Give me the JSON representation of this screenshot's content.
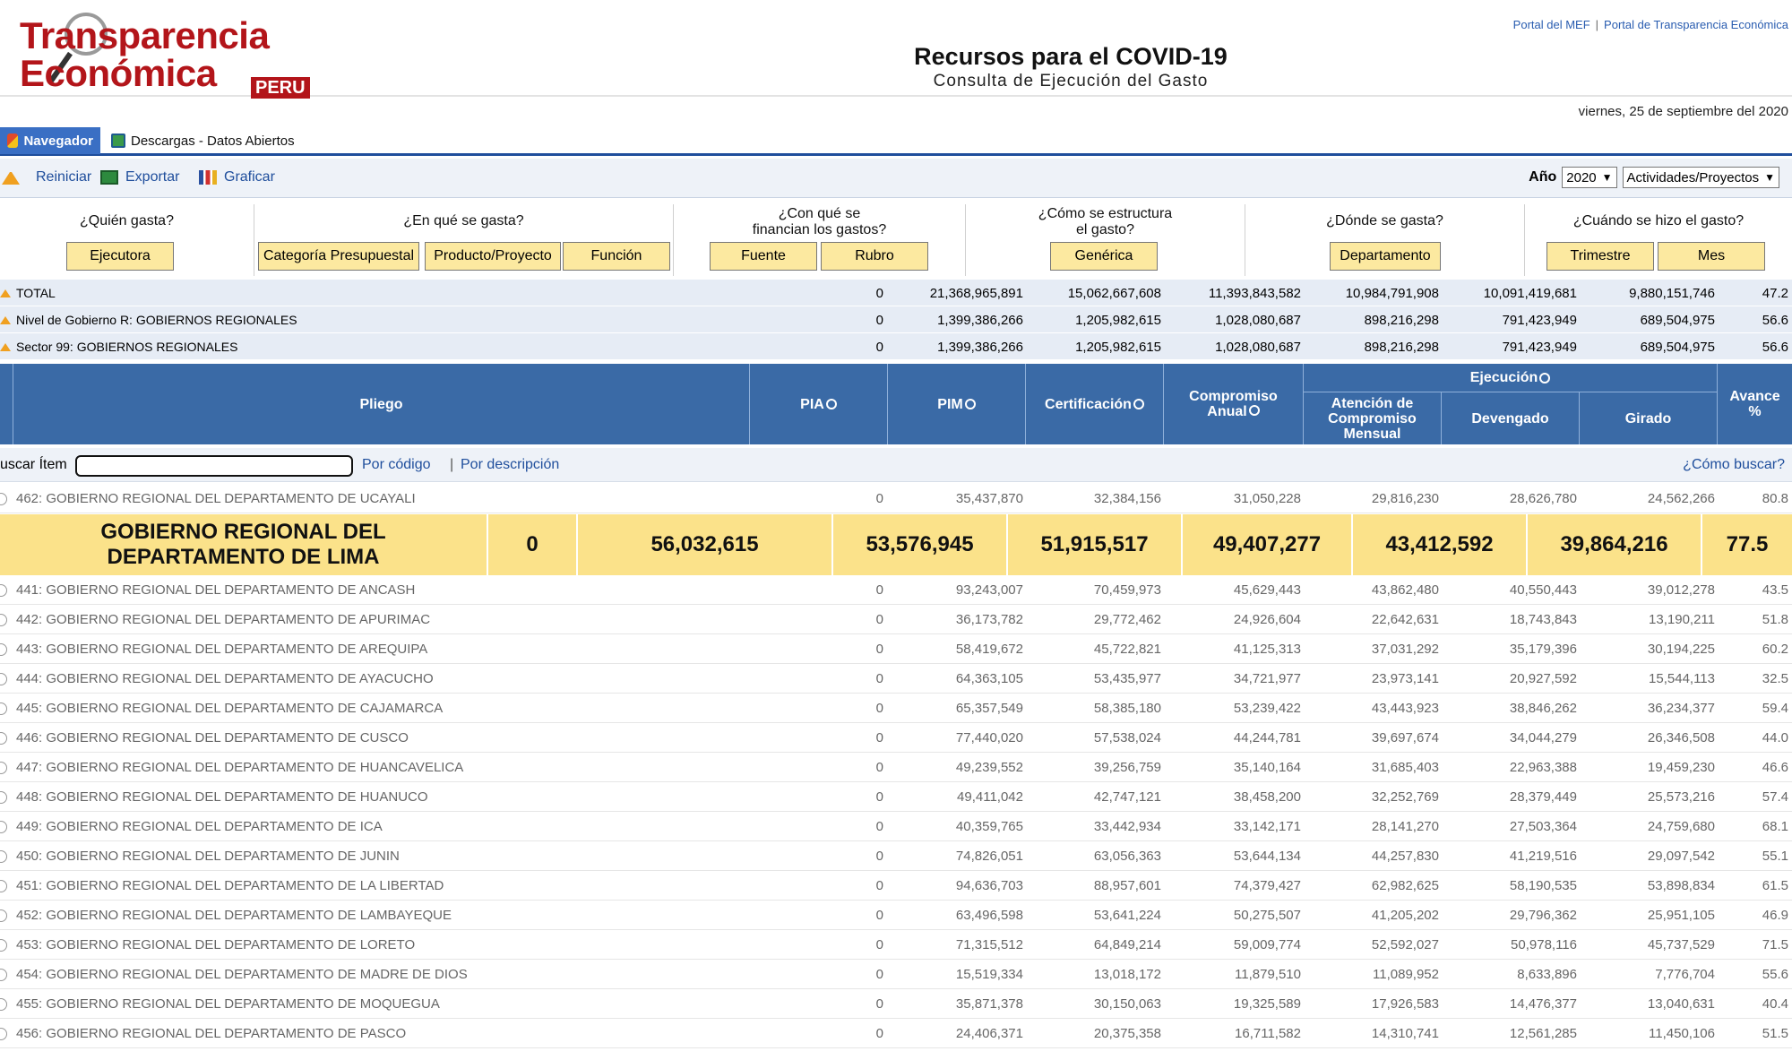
{
  "header": {
    "logo_line1": "Transparencia",
    "logo_line2": "Económica",
    "logo_peru": "PERU",
    "link1": "Portal del MEF",
    "link_sep": "|",
    "link2": "Portal de Transparencia Económica",
    "title": "Recursos para el COVID-19",
    "subtitle": "Consulta de Ejecución del Gasto",
    "date": "viernes, 25 de septiembre del 2020"
  },
  "tabs": {
    "navigator": "Navegador",
    "downloads": "Descargas - Datos Abiertos"
  },
  "toolbar": {
    "reset": "Reiniciar",
    "export": "Exportar",
    "graph": "Graficar",
    "year_label": "Año",
    "year_value": "2020",
    "view_value": "Actividades/Proyectos"
  },
  "questions": {
    "who": "¿Quién gasta?",
    "what": "¿En qué se gasta?",
    "funding_1": "¿Con qué se",
    "funding_2": "financian los gastos?",
    "structure_1": "¿Cómo se estructura",
    "structure_2": "el gasto?",
    "where": "¿Dónde se gasta?",
    "when": "¿Cuándo se hizo el gasto?",
    "btn_executor": "Ejecutora",
    "btn_category": "Categoría Presupuestal",
    "btn_product": "Producto/Proyecto",
    "btn_function": "Función",
    "btn_source": "Fuente",
    "btn_item": "Rubro",
    "btn_generic": "Genérica",
    "btn_department": "Departamento",
    "btn_quarter": "Trimestre",
    "btn_month": "Mes"
  },
  "summary": [
    {
      "label": "TOTAL",
      "pia": "0",
      "pim": "21,368,965,891",
      "cert": "15,062,667,608",
      "comp": "11,393,843,582",
      "aten": "10,984,791,908",
      "dev": "10,091,419,681",
      "gir": "9,880,151,746",
      "av": "47.2"
    },
    {
      "label": "Nivel de Gobierno R: GOBIERNOS REGIONALES",
      "pia": "0",
      "pim": "1,399,386,266",
      "cert": "1,205,982,615",
      "comp": "1,028,080,687",
      "aten": "898,216,298",
      "dev": "791,423,949",
      "gir": "689,504,975",
      "av": "56.6"
    },
    {
      "label": "Sector 99: GOBIERNOS REGIONALES",
      "pia": "0",
      "pim": "1,399,386,266",
      "cert": "1,205,982,615",
      "comp": "1,028,080,687",
      "aten": "898,216,298",
      "dev": "791,423,949",
      "gir": "689,504,975",
      "av": "56.6"
    }
  ],
  "columns": {
    "pliego": "Pliego",
    "pia": "PIA",
    "pim": "PIM",
    "cert": "Certificación",
    "comp_1": "Compromiso",
    "comp_2": "Anual",
    "ejec": "Ejecución",
    "aten_1": "Atención de",
    "aten_2": "Compromiso",
    "aten_3": "Mensual",
    "dev": "Devengado",
    "gir": "Girado",
    "av_1": "Avance",
    "av_2": "%"
  },
  "search": {
    "label": "uscar Ítem",
    "by_code": "Por código",
    "sep": "|",
    "by_desc": "Por descripción",
    "how": "¿Cómo buscar?"
  },
  "highlight": {
    "name_1": "GOBIERNO REGIONAL DEL",
    "name_2": "DEPARTAMENTO DE LIMA",
    "pia": "0",
    "pim": "56,032,615",
    "cert": "53,576,945",
    "comp": "51,915,517",
    "aten": "49,407,277",
    "dev": "43,412,592",
    "gir": "39,864,216",
    "av": "77.5"
  },
  "rows": [
    {
      "name": "462: GOBIERNO REGIONAL DEL DEPARTAMENTO DE UCAYALI",
      "pia": "0",
      "pim": "35,437,870",
      "cert": "32,384,156",
      "comp": "31,050,228",
      "aten": "29,816,230",
      "dev": "28,626,780",
      "gir": "24,562,266",
      "av": "80.8"
    },
    {
      "name": "441: GOBIERNO REGIONAL DEL DEPARTAMENTO DE ANCASH",
      "pia": "0",
      "pim": "93,243,007",
      "cert": "70,459,973",
      "comp": "45,629,443",
      "aten": "43,862,480",
      "dev": "40,550,443",
      "gir": "39,012,278",
      "av": "43.5"
    },
    {
      "name": "442: GOBIERNO REGIONAL DEL DEPARTAMENTO DE APURIMAC",
      "pia": "0",
      "pim": "36,173,782",
      "cert": "29,772,462",
      "comp": "24,926,604",
      "aten": "22,642,631",
      "dev": "18,743,843",
      "gir": "13,190,211",
      "av": "51.8"
    },
    {
      "name": "443: GOBIERNO REGIONAL DEL DEPARTAMENTO DE AREQUIPA",
      "pia": "0",
      "pim": "58,419,672",
      "cert": "45,722,821",
      "comp": "41,125,313",
      "aten": "37,031,292",
      "dev": "35,179,396",
      "gir": "30,194,225",
      "av": "60.2"
    },
    {
      "name": "444: GOBIERNO REGIONAL DEL DEPARTAMENTO DE AYACUCHO",
      "pia": "0",
      "pim": "64,363,105",
      "cert": "53,435,977",
      "comp": "34,721,977",
      "aten": "23,973,141",
      "dev": "20,927,592",
      "gir": "15,544,113",
      "av": "32.5"
    },
    {
      "name": "445: GOBIERNO REGIONAL DEL DEPARTAMENTO DE CAJAMARCA",
      "pia": "0",
      "pim": "65,357,549",
      "cert": "58,385,180",
      "comp": "53,239,422",
      "aten": "43,443,923",
      "dev": "38,846,262",
      "gir": "36,234,377",
      "av": "59.4"
    },
    {
      "name": "446: GOBIERNO REGIONAL DEL DEPARTAMENTO DE CUSCO",
      "pia": "0",
      "pim": "77,440,020",
      "cert": "57,538,024",
      "comp": "44,244,781",
      "aten": "39,697,674",
      "dev": "34,044,279",
      "gir": "26,346,508",
      "av": "44.0"
    },
    {
      "name": "447: GOBIERNO REGIONAL DEL DEPARTAMENTO DE HUANCAVELICA",
      "pia": "0",
      "pim": "49,239,552",
      "cert": "39,256,759",
      "comp": "35,140,164",
      "aten": "31,685,403",
      "dev": "22,963,388",
      "gir": "19,459,230",
      "av": "46.6"
    },
    {
      "name": "448: GOBIERNO REGIONAL DEL DEPARTAMENTO DE HUANUCO",
      "pia": "0",
      "pim": "49,411,042",
      "cert": "42,747,121",
      "comp": "38,458,200",
      "aten": "32,252,769",
      "dev": "28,379,449",
      "gir": "25,573,216",
      "av": "57.4"
    },
    {
      "name": "449: GOBIERNO REGIONAL DEL DEPARTAMENTO DE ICA",
      "pia": "0",
      "pim": "40,359,765",
      "cert": "33,442,934",
      "comp": "33,142,171",
      "aten": "28,141,270",
      "dev": "27,503,364",
      "gir": "24,759,680",
      "av": "68.1"
    },
    {
      "name": "450: GOBIERNO REGIONAL DEL DEPARTAMENTO DE JUNIN",
      "pia": "0",
      "pim": "74,826,051",
      "cert": "63,056,363",
      "comp": "53,644,134",
      "aten": "44,257,830",
      "dev": "41,219,516",
      "gir": "29,097,542",
      "av": "55.1"
    },
    {
      "name": "451: GOBIERNO REGIONAL DEL DEPARTAMENTO DE LA LIBERTAD",
      "pia": "0",
      "pim": "94,636,703",
      "cert": "88,957,601",
      "comp": "74,379,427",
      "aten": "62,982,625",
      "dev": "58,190,535",
      "gir": "53,898,834",
      "av": "61.5"
    },
    {
      "name": "452: GOBIERNO REGIONAL DEL DEPARTAMENTO DE LAMBAYEQUE",
      "pia": "0",
      "pim": "63,496,598",
      "cert": "53,641,224",
      "comp": "50,275,507",
      "aten": "41,205,202",
      "dev": "29,796,362",
      "gir": "25,951,105",
      "av": "46.9"
    },
    {
      "name": "453: GOBIERNO REGIONAL DEL DEPARTAMENTO DE LORETO",
      "pia": "0",
      "pim": "71,315,512",
      "cert": "64,849,214",
      "comp": "59,009,774",
      "aten": "52,592,027",
      "dev": "50,978,116",
      "gir": "45,737,529",
      "av": "71.5"
    },
    {
      "name": "454: GOBIERNO REGIONAL DEL DEPARTAMENTO DE MADRE DE DIOS",
      "pia": "0",
      "pim": "15,519,334",
      "cert": "13,018,172",
      "comp": "11,879,510",
      "aten": "11,089,952",
      "dev": "8,633,896",
      "gir": "7,776,704",
      "av": "55.6"
    },
    {
      "name": "455: GOBIERNO REGIONAL DEL DEPARTAMENTO DE MOQUEGUA",
      "pia": "0",
      "pim": "35,871,378",
      "cert": "30,150,063",
      "comp": "19,325,589",
      "aten": "17,926,583",
      "dev": "14,476,377",
      "gir": "13,040,631",
      "av": "40.4"
    },
    {
      "name": "456: GOBIERNO REGIONAL DEL DEPARTAMENTO DE PASCO",
      "pia": "0",
      "pim": "24,406,371",
      "cert": "20,375,358",
      "comp": "16,711,582",
      "aten": "14,310,741",
      "dev": "12,561,285",
      "gir": "11,450,106",
      "av": "51.5"
    }
  ]
}
